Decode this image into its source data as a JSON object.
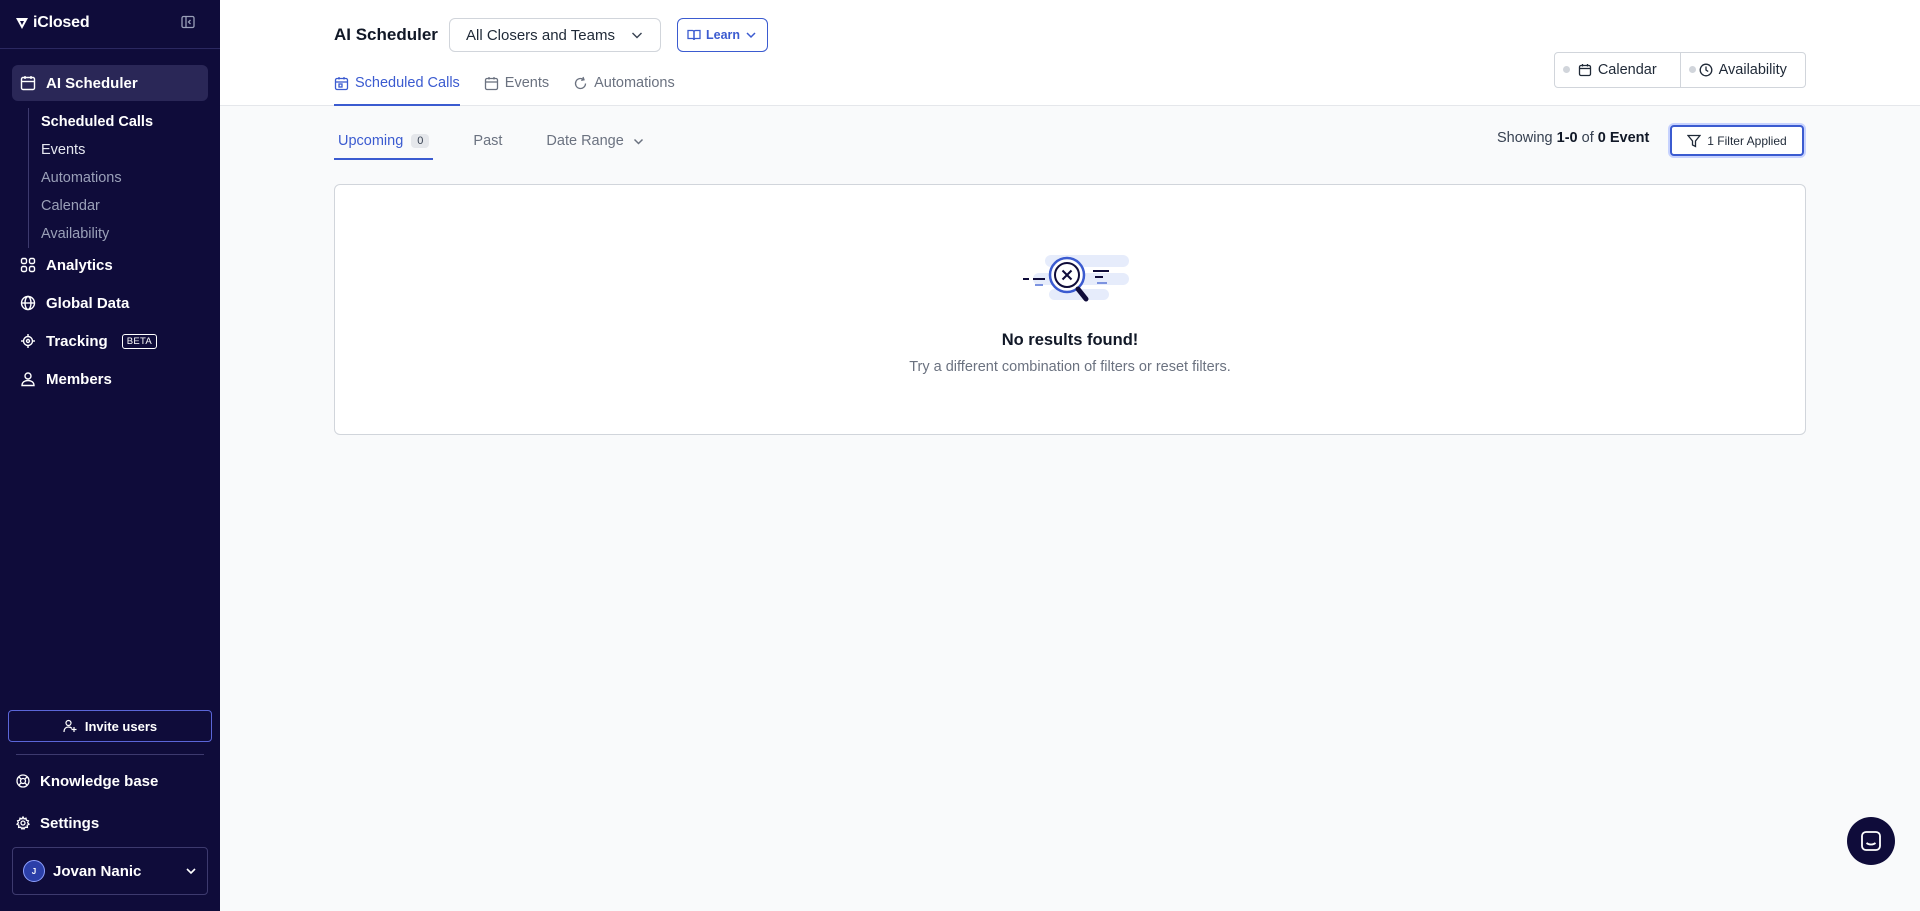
{
  "brand": {
    "name": "iClosed"
  },
  "sidebar": {
    "active": {
      "label": "AI Scheduler"
    },
    "subnav": [
      {
        "label": "Scheduled Calls"
      },
      {
        "label": "Events"
      },
      {
        "label": "Automations"
      },
      {
        "label": "Calendar"
      },
      {
        "label": "Availability"
      }
    ],
    "items": [
      {
        "label": "Analytics"
      },
      {
        "label": "Global Data"
      },
      {
        "label": "Tracking",
        "badge": "BETA"
      },
      {
        "label": "Members"
      }
    ],
    "invite_label": "Invite users",
    "knowledge_base": "Knowledge base",
    "settings": "Settings",
    "user": {
      "initials": "J",
      "name": "Jovan Nanic"
    }
  },
  "header": {
    "title": "AI Scheduler",
    "team_select": "All Closers and Teams",
    "learn_label": "Learn",
    "tabs": [
      {
        "label": "Scheduled Calls"
      },
      {
        "label": "Events"
      },
      {
        "label": "Automations"
      }
    ],
    "views": [
      {
        "label": "Calendar"
      },
      {
        "label": "Availability"
      }
    ]
  },
  "filters": {
    "upcoming_label": "Upcoming",
    "upcoming_count": "0",
    "past_label": "Past",
    "date_range_label": "Date Range",
    "showing_prefix": "Showing",
    "showing_range": "1-0",
    "showing_of": "of",
    "showing_total": "0 Event",
    "filter_label": "1 Filter Applied"
  },
  "empty_state": {
    "title": "No results found!",
    "subtitle": "Try a different combination of filters or reset filters."
  },
  "colors": {
    "sidebar_bg": "#0f0c3a",
    "accent": "#3b5bd0"
  }
}
